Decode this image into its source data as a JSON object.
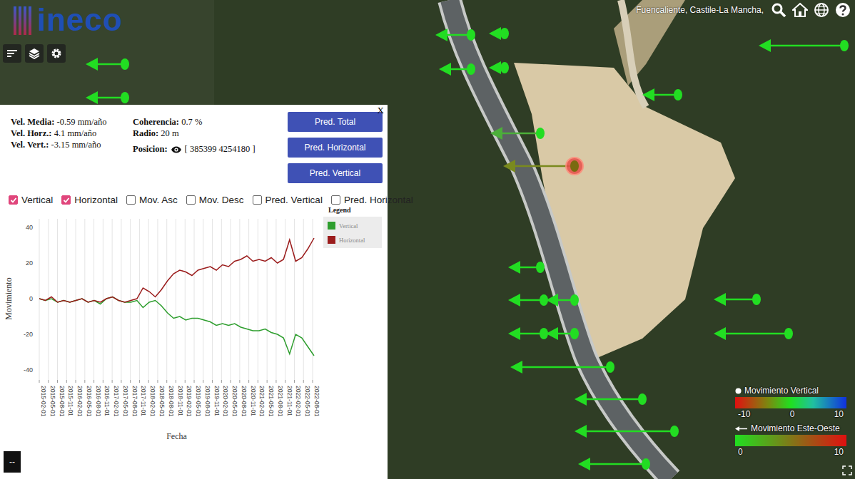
{
  "location": "Fuencaliente, Castile-La Mancha,",
  "logo": "ineco",
  "panel": {
    "close": "X",
    "stats": [
      {
        "label": "Vel. Media:",
        "value": "-0.59 mm/año"
      },
      {
        "label": "Vel. Horz.:",
        "value": "4.1 mm/año"
      },
      {
        "label": "Vel. Vert.:",
        "value": "-3.15 mm/año"
      }
    ],
    "stats2": [
      {
        "label": "Coherencia:",
        "value": "0.7 %"
      },
      {
        "label": "Radio:",
        "value": "20 m"
      }
    ],
    "position": {
      "label": "Posicion:",
      "value": "[ 385399 4254180 ]"
    },
    "buttons": [
      "Pred. Total",
      "Pred. Horizontal",
      "Pred. Vertical"
    ],
    "checkboxes": [
      {
        "label": "Vertical",
        "checked": true
      },
      {
        "label": "Horizontal",
        "checked": true
      },
      {
        "label": "Mov. Asc",
        "checked": false
      },
      {
        "label": "Mov. Desc",
        "checked": false
      },
      {
        "label": "Pred. Vertical",
        "checked": false
      },
      {
        "label": "Pred. Horizontal",
        "checked": false
      }
    ],
    "chart": {
      "y_label": "Movimiento",
      "x_label": "Fecha",
      "legend_title": "Legend",
      "y_ticks": [
        "40",
        "20",
        "0",
        "-20",
        "-40"
      ],
      "x_ticks": [
        "2015-02-01",
        "2015-05-01",
        "2015-08-01",
        "2015-11-01",
        "2016-02-01",
        "2016-05-01",
        "2016-08-01",
        "2016-11-01",
        "2017-02-01",
        "2017-05-01",
        "2017-08-01",
        "2017-11-01",
        "2018-02-01",
        "2018-05-01",
        "2018-08-01",
        "2018-11-01",
        "2019-02-01",
        "2019-05-01",
        "2019-08-01",
        "2019-11-01",
        "2020-02-01",
        "2020-05-01",
        "2020-08-01",
        "2020-11-01",
        "2021-02-01",
        "2021-05-01",
        "2021-08-01",
        "2021-11-01",
        "2022-02-01",
        "2022-05-01",
        "2022-08-01"
      ],
      "series": [
        {
          "name": "Vertical",
          "color": "#2e9e2e",
          "values": [
            0,
            -1,
            0,
            -2,
            -1,
            -2,
            -1,
            0,
            -2,
            -1,
            -3,
            0,
            1,
            -1,
            -2,
            -2,
            -1,
            -5,
            -2,
            -1,
            -4,
            -8,
            -11,
            -10,
            -12,
            -11,
            -11,
            -12,
            -13,
            -15,
            -14,
            -15,
            -14,
            -16,
            -17,
            -18,
            -18,
            -17,
            -19,
            -20,
            -22,
            -31,
            -20,
            -22,
            -27,
            -32
          ]
        },
        {
          "name": "Horizontal",
          "color": "#9b1c1c",
          "values": [
            0,
            -1,
            1,
            -2,
            -1,
            -2,
            -1,
            0,
            -2,
            -1,
            -2,
            0,
            1,
            -1,
            -2,
            -1,
            0,
            6,
            4,
            1,
            5,
            10,
            14,
            16,
            15,
            13,
            16,
            17,
            18,
            16,
            19,
            18,
            21,
            22,
            24,
            21,
            22,
            21,
            23,
            20,
            22,
            33,
            21,
            23,
            28,
            34
          ]
        }
      ]
    }
  },
  "corner_button": "--",
  "legend": {
    "vertical": {
      "title": "Movimiento Vertical",
      "ticks": [
        "-10",
        "0",
        "10"
      ]
    },
    "east_west": {
      "title": "Movimiento Este-Oeste",
      "ticks": [
        "0",
        "10"
      ]
    }
  },
  "markers": [
    {
      "arrow_color": "#22dd22",
      "dot_color": "#22dd22",
      "selected": false
    },
    {
      "arrow_color": "#22dd22",
      "dot_color": "#22dd22",
      "selected": false
    },
    {
      "arrow_color": "#22dd22",
      "dot_color": "#22dd22",
      "selected": false
    },
    {
      "arrow_color": "#22dd22",
      "dot_color": "#22dd22",
      "selected": false
    },
    {
      "arrow_color": "#22dd22",
      "dot_color": "#22dd22",
      "selected": false
    },
    {
      "arrow_color": "#22dd22",
      "dot_color": "#22dd22",
      "selected": false
    },
    {
      "arrow_color": "#4caf3a",
      "dot_color": "#22dd22",
      "selected": false
    },
    {
      "arrow_color": "#22dd22",
      "dot_color": "#22dd22",
      "selected": false
    },
    {
      "arrow_color": "#22dd22",
      "dot_color": "#22dd22",
      "selected": false
    },
    {
      "arrow_color": "#7a8a1e",
      "dot_color": "#7a6a10",
      "selected": true
    },
    {
      "arrow_color": "#22dd22",
      "dot_color": "#22dd22",
      "selected": false
    },
    {
      "arrow_color": "#22dd22",
      "dot_color": "#22dd22",
      "selected": false
    },
    {
      "arrow_color": "#22dd22",
      "dot_color": "#22dd22",
      "selected": false
    },
    {
      "arrow_color": "#22dd22",
      "dot_color": "#22dd22",
      "selected": false
    },
    {
      "arrow_color": "#22dd22",
      "dot_color": "#22dd22",
      "selected": false
    },
    {
      "arrow_color": "#22dd22",
      "dot_color": "#22dd22",
      "selected": false
    },
    {
      "arrow_color": "#22dd22",
      "dot_color": "#22dd22",
      "selected": false
    },
    {
      "arrow_color": "#22dd22",
      "dot_color": "#22dd22",
      "selected": false
    },
    {
      "arrow_color": "#22dd22",
      "dot_color": "#22dd22",
      "selected": false
    },
    {
      "arrow_color": "#22dd22",
      "dot_color": "#22dd22",
      "selected": false
    },
    {
      "arrow_color": "#22dd22",
      "dot_color": "#22dd22",
      "selected": false
    }
  ]
}
